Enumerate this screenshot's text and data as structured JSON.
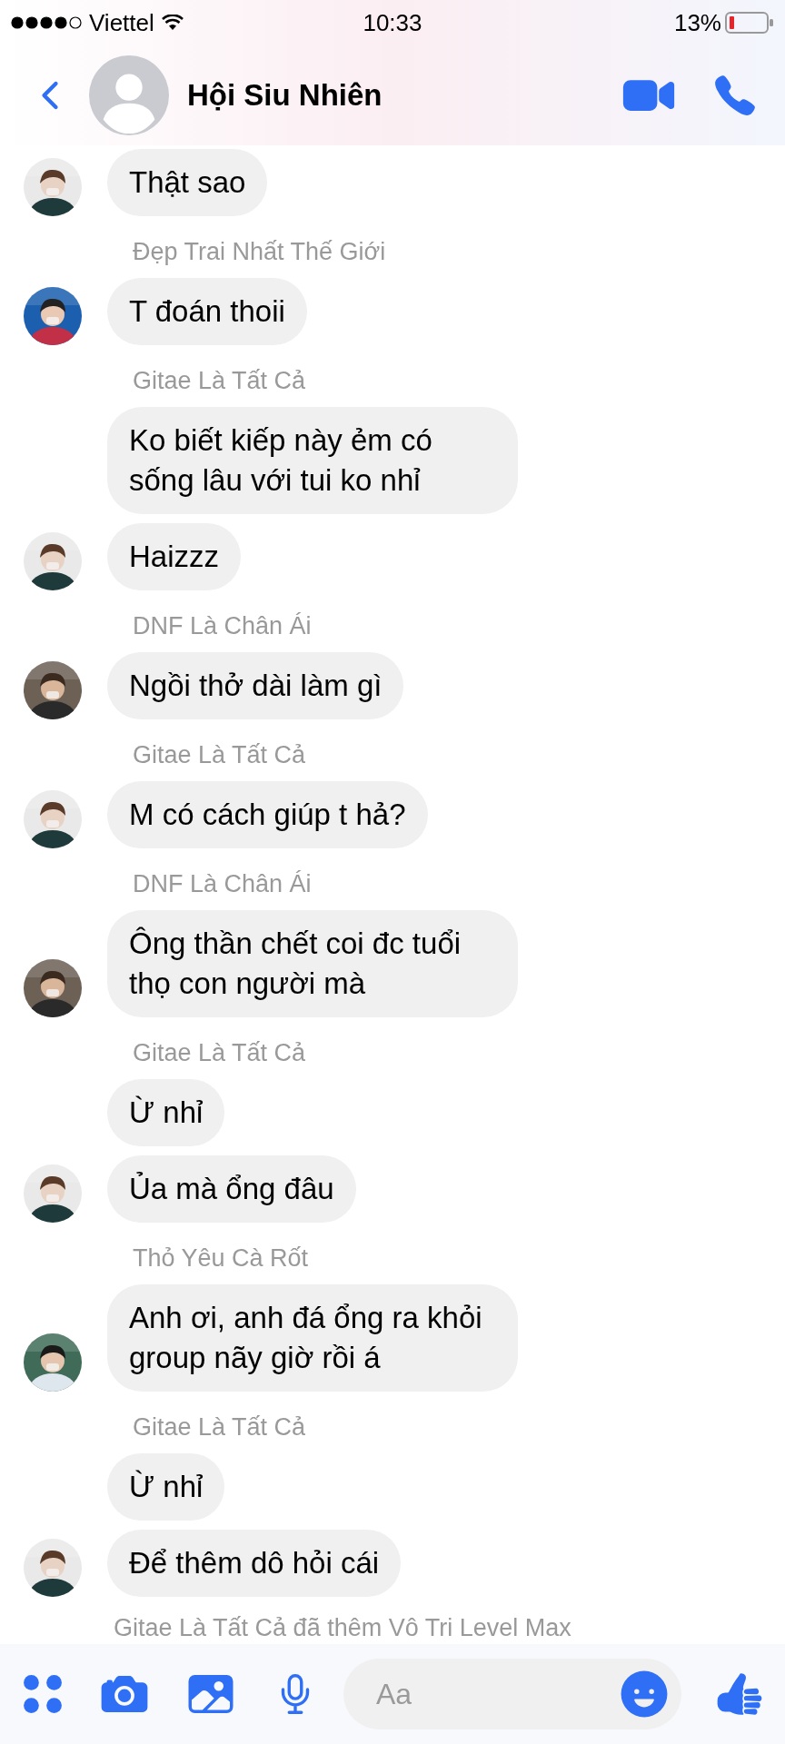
{
  "status_bar": {
    "carrier": "Viettel",
    "time": "10:33",
    "battery": "13%"
  },
  "header": {
    "title": "Hội Siu Nhiên"
  },
  "groups": [
    {
      "messages": [
        "Thật sao"
      ]
    },
    {
      "sender": "Đẹp Trai Nhất Thế Giới",
      "messages": [
        "T đoán thoii"
      ]
    },
    {
      "sender": "Gitae Là Tất Cả",
      "messages": [
        "Ko biết kiếp này ẻm có sống lâu với tui ko nhỉ",
        "Haizzz"
      ]
    },
    {
      "sender": "DNF Là Chân Ái",
      "messages": [
        "Ngồi thở dài làm gì"
      ]
    },
    {
      "sender": "Gitae Là Tất Cả",
      "messages": [
        "M có cách giúp t hả?"
      ]
    },
    {
      "sender": "DNF Là Chân Ái",
      "messages": [
        "Ông thần chết coi đc tuổi thọ con người mà"
      ]
    },
    {
      "sender": "Gitae Là Tất Cả",
      "messages": [
        "Ừ nhỉ",
        "Ủa mà ổng đâu"
      ]
    },
    {
      "sender": "Thỏ Yêu Cà Rốt",
      "messages": [
        "Anh ơi, anh đá ổng ra khỏi group nãy giờ rồi á"
      ]
    },
    {
      "sender": "Gitae Là Tất Cả",
      "messages": [
        "Ừ nhỉ",
        "Để thêm dô hỏi cái"
      ]
    }
  ],
  "system_message": "Gitae Là Tất Cả đã thêm Vô Tri Level Max",
  "composer": {
    "placeholder": "Aa"
  }
}
